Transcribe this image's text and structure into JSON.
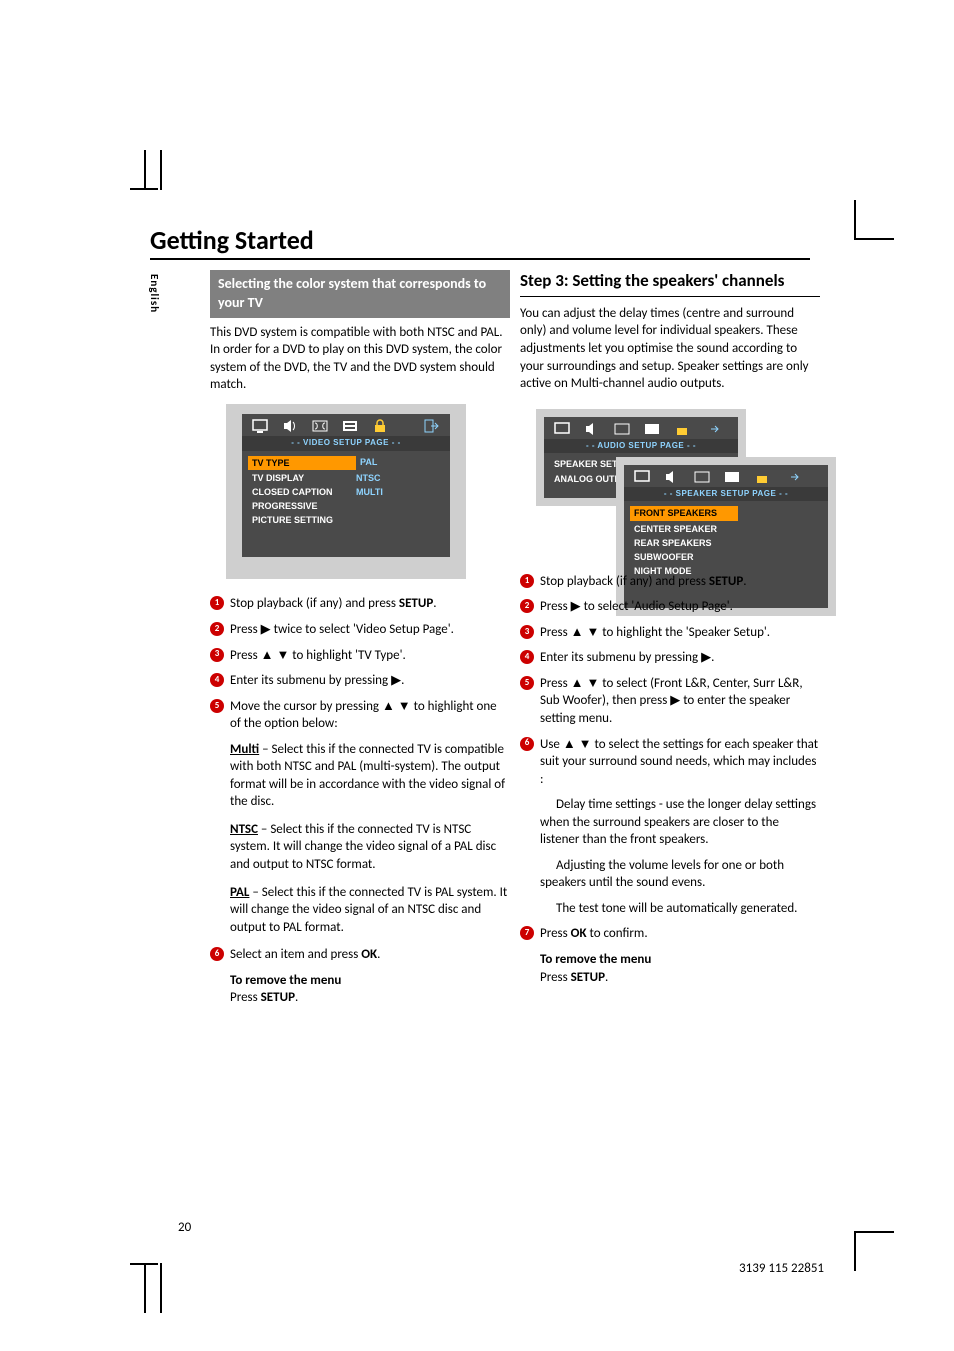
{
  "language_tab": "English",
  "page_title": "Getting Started",
  "left": {
    "section_heading": "Selecting the color system that corresponds to your TV",
    "intro": "This DVD system is compatible with both NTSC and PAL.  In order for a DVD to play on this DVD system, the color system of the DVD, the TV and the DVD system should match.",
    "osd": {
      "title": "- -   VIDEO  SETUP  PAGE   - -",
      "rows": [
        {
          "label": "TV TYPE",
          "value": "PAL",
          "selected": true
        },
        {
          "label": "TV DISPLAY",
          "value": "NTSC"
        },
        {
          "label": "CLOSED CAPTION",
          "value": "MULTI"
        },
        {
          "label": "PROGRESSIVE",
          "value": ""
        },
        {
          "label": "PICTURE SETTING",
          "value": ""
        }
      ]
    },
    "steps": {
      "s1": "Stop playback (if any) and press ",
      "s1b": "SETUP",
      "s1c": ".",
      "s2a": "Press ",
      "s2b": " twice to select 'Video Setup Page'.",
      "s3a": "Press ",
      "s3b": " to highlight 'TV Type'.",
      "s4a": "Enter its submenu by pressing ",
      "s4b": ".",
      "s5a": "Move the cursor by pressing ",
      "s5b": " to highlight one of the option below:",
      "multi_label": "Multi",
      "multi_text": " – Select this if the connected TV is compatible with both NTSC and PAL (multi-system).  The output format will be in accordance with the video signal of the disc.",
      "ntsc_label": "NTSC",
      "ntsc_text": " – Select this if the connected TV is NTSC system. It will change the video signal of a PAL disc and output to NTSC format.",
      "pal_label": "PAL",
      "pal_text": " – Select this if the connected TV is PAL system. It will change the video signal of an NTSC disc and output to PAL format.",
      "s6a": "Select an item and press ",
      "s6b": "OK",
      "s6c": ".",
      "remove_head": "To remove the menu",
      "remove_a": "Press ",
      "remove_b": "SETUP",
      "remove_c": "."
    }
  },
  "right": {
    "step_heading": "Step 3:  Setting the speakers' channels",
    "intro": "You can adjust the delay times (centre and surround only) and volume level for individual speakers.  These adjustments let you optimise the sound according to your surroundings and setup.  Speaker settings are only active on Multi-channel audio outputs.",
    "osd1": {
      "title": "- -   AUDIO  SETUP  PAGE   - -",
      "rows": [
        {
          "label": "SPEAKER SETUP",
          "selected": true
        },
        {
          "label": "ANALOG OUTPUT"
        }
      ]
    },
    "osd2": {
      "title": "- -   SPEAKER  SETUP  PAGE   - -",
      "rows": [
        {
          "label": "FRONT SPEAKERS",
          "selected": true
        },
        {
          "label": "CENTER SPEAKER"
        },
        {
          "label": "REAR SPEAKERS"
        },
        {
          "label": "SUBWOOFER"
        },
        {
          "label": "NIGHT MODE"
        }
      ]
    },
    "steps": {
      "s1": "Stop playback (if any) and press ",
      "s1b": "SETUP",
      "s1c": ".",
      "s2a": "Press ",
      "s2b": " to select 'Audio Setup Page'.",
      "s3a": "Press ",
      "s3b": " to highlight the 'Speaker Setup'.",
      "s4a": "Enter its submenu by pressing ",
      "s4b": ".",
      "s5a": "Press ",
      "s5b": " to select (Front L&R, Center, Surr L&R, Sub Woofer), then press ",
      "s5c": " to enter the speaker setting menu.",
      "s6a": "Use ",
      "s6b": " to select the settings for each speaker that suit your surround sound needs, which may includes :",
      "delay_text": "Delay time settings - use the longer delay settings when the surround speakers are closer to the listener than the front speakers.",
      "adjust_text": "Adjusting the volume levels for one or both speakers until the sound evens.",
      "tone_text": "The test tone will be automatically generated.",
      "s7a": "Press ",
      "s7b": "OK",
      "s7c": " to confirm.",
      "remove_head": "To remove the menu",
      "remove_a": "Press ",
      "remove_b": "SETUP",
      "remove_c": "."
    }
  },
  "glyphs": {
    "right": "▶",
    "updown": "▲ ▼"
  },
  "footer": {
    "page": "20",
    "code": "3139 115 22851"
  }
}
